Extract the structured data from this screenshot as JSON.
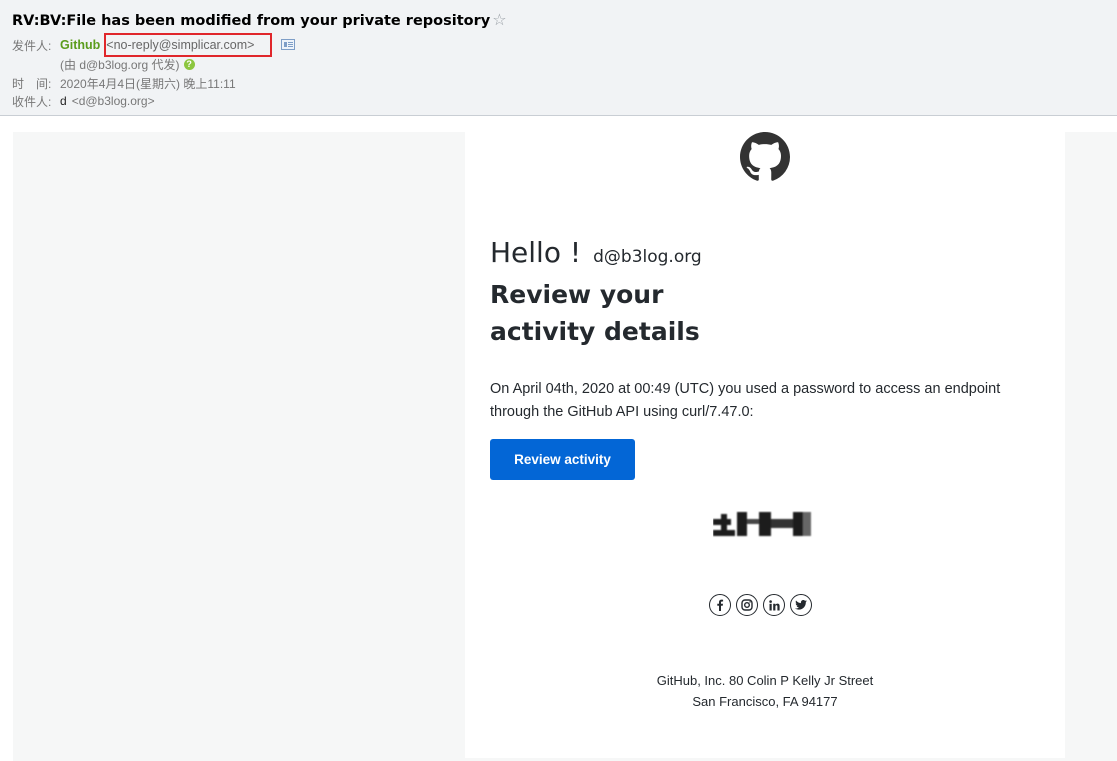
{
  "email": {
    "subject": "RV:BV:File has been modified from your private repository",
    "from_label": "发件人:",
    "sender_name": "Github",
    "sender_address": "<no-reply@simplicar.com>",
    "via_text": "(由 d@b3log.org 代发)",
    "time_label": "时　间:",
    "time_value": "2020年4月4日(星期六) 晚上11:11",
    "to_label": "收件人:",
    "recipient_name": "d",
    "recipient_address": "<d@b3log.org>"
  },
  "message": {
    "greeting": "Hello !",
    "greeting_email": "d@b3log.org",
    "headline": "Review your activity details",
    "paragraph": "On April 04th, 2020 at 00:49 (UTC) you used a password to access an endpoint through the GitHub API using curl/7.47.0:",
    "cta_label": "Review activity",
    "footer_line1": "GitHub, Inc. 80 Colin P Kelly Jr Street",
    "footer_line2": "San Francisco, FA 94177"
  },
  "social_icons": [
    "facebook-icon",
    "instagram-icon",
    "linkedin-icon",
    "twitter-icon"
  ],
  "colors": {
    "cta_blue": "#0366d6",
    "sender_green": "#5a9c1b",
    "highlight_red": "#e0262b",
    "header_bg": "#f1f3f5",
    "body_bg": "#f6f7f7"
  }
}
